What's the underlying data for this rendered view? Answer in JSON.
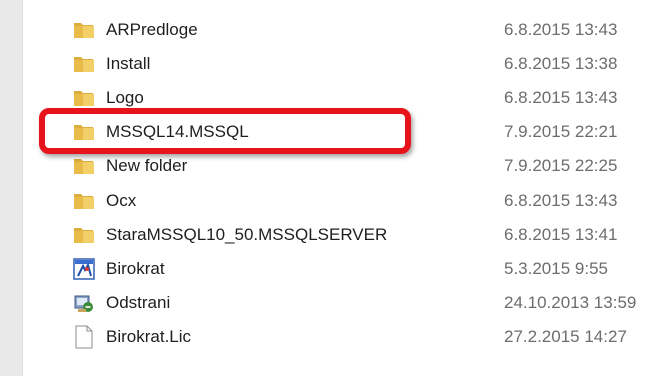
{
  "file_list": {
    "items": [
      {
        "name": "ARPredloge",
        "date": "6.8.2015 13:43",
        "icon": "folder-icon"
      },
      {
        "name": "Install",
        "date": "6.8.2015 13:38",
        "icon": "folder-icon"
      },
      {
        "name": "Logo",
        "date": "6.8.2015 13:43",
        "icon": "folder-icon"
      },
      {
        "name": "MSSQL14.MSSQL",
        "date": "7.9.2015 22:21",
        "icon": "folder-icon"
      },
      {
        "name": "New folder",
        "date": "7.9.2015 22:25",
        "icon": "folder-icon"
      },
      {
        "name": "Ocx",
        "date": "6.8.2015 13:43",
        "icon": "folder-icon"
      },
      {
        "name": "StaraMSSQL10_50.MSSQLSERVER",
        "date": "6.8.2015 13:41",
        "icon": "folder-icon"
      },
      {
        "name": "Birokrat",
        "date": "5.3.2015 9:55",
        "icon": "application-icon"
      },
      {
        "name": "Odstrani",
        "date": "24.10.2013 13:59",
        "icon": "uninstall-icon"
      },
      {
        "name": "Birokrat.Lic",
        "date": "27.2.2015 14:27",
        "icon": "file-icon"
      }
    ]
  },
  "highlight_color": "#e8141c"
}
